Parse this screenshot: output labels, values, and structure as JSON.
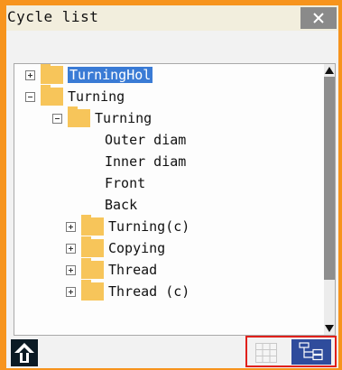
{
  "window": {
    "title": "Cycle list"
  },
  "tree": {
    "items": [
      {
        "label": "TurningHol",
        "expander": "plus",
        "folder": true,
        "selected": true
      },
      {
        "label": "Turning",
        "expander": "minus",
        "folder": true,
        "selected": false
      },
      {
        "label": "Turning",
        "expander": "minus",
        "folder": true,
        "selected": false
      },
      {
        "label": "Outer diam",
        "expander": null,
        "folder": false,
        "selected": false
      },
      {
        "label": "Inner diam",
        "expander": null,
        "folder": false,
        "selected": false
      },
      {
        "label": "Front",
        "expander": null,
        "folder": false,
        "selected": false
      },
      {
        "label": "Back",
        "expander": null,
        "folder": false,
        "selected": false
      },
      {
        "label": "Turning(c)",
        "expander": "plus",
        "folder": true,
        "selected": false
      },
      {
        "label": "Copying",
        "expander": "plus",
        "folder": true,
        "selected": false
      },
      {
        "label": "Thread",
        "expander": "plus",
        "folder": true,
        "selected": false
      },
      {
        "label": "Thread (c)",
        "expander": "plus",
        "folder": true,
        "selected": false
      }
    ]
  },
  "icons": {
    "close": "close-icon",
    "up": "up-arrow-icon",
    "grid_view": "grid-view-icon",
    "tree_view": "tree-view-icon",
    "folder": "folder-icon"
  },
  "colors": {
    "frame": "#f7941d",
    "selection": "#3a7bd5",
    "folder": "#f7c55a",
    "active_view_button": "#2f4c9c",
    "highlight_box": "#e0201b"
  }
}
